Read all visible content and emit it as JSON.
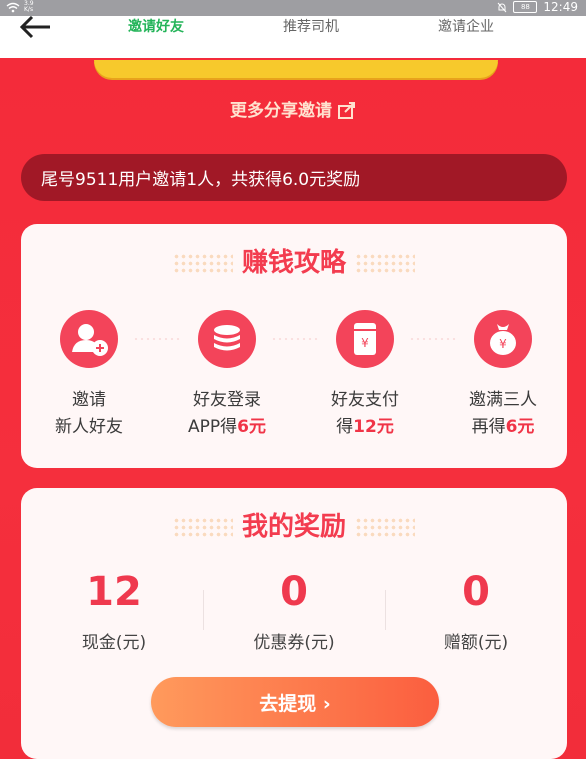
{
  "status": {
    "speed_top": "3.9",
    "speed_bottom": "K/s",
    "battery": "88",
    "time": "12:49"
  },
  "header": {
    "tabs": [
      {
        "label": "邀请好友",
        "active": true
      },
      {
        "label": "推荐司机",
        "active": false
      },
      {
        "label": "邀请企业",
        "active": false
      }
    ]
  },
  "share": {
    "label": "更多分享邀请"
  },
  "notice": {
    "text": "尾号9511用户邀请1人，共获得6.0元奖励"
  },
  "guide": {
    "title": "赚钱攻略",
    "steps": [
      {
        "icon": "add-user-icon",
        "line1": "邀请",
        "line2_pre": "新人好友",
        "line2_hl": "",
        "line2_post": ""
      },
      {
        "icon": "coins-icon",
        "line1": "好友登录",
        "line2_pre": "APP得",
        "line2_hl": "6元",
        "line2_post": ""
      },
      {
        "icon": "yuan-card-icon",
        "line1": "好友支付",
        "line2_pre": "得",
        "line2_hl": "12元",
        "line2_post": ""
      },
      {
        "icon": "money-bag-icon",
        "line1": "邀满三人",
        "line2_pre": "再得",
        "line2_hl": "6元",
        "line2_post": ""
      }
    ]
  },
  "my_rewards": {
    "title": "我的奖励",
    "items": [
      {
        "value": "12",
        "label": "现金(元)"
      },
      {
        "value": "0",
        "label": "优惠券(元)"
      },
      {
        "value": "0",
        "label": "赠额(元)"
      }
    ]
  },
  "withdraw": {
    "label": "去提现 ›"
  },
  "colors": {
    "accent_red": "#f52d3b",
    "active_tab": "#25b45a",
    "highlight": "#f03447"
  }
}
